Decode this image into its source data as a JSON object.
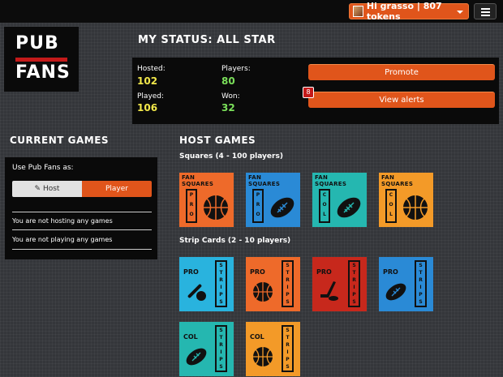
{
  "topbar": {
    "user_label": "Hi grasso | 807 tokens"
  },
  "logo": {
    "line1": "PUB",
    "line2": "FANS"
  },
  "status": {
    "title": "MY STATUS: ALL STAR",
    "hosted_label": "Hosted:",
    "hosted": "102",
    "players_label": "Players:",
    "players": "80",
    "played_label": "Played:",
    "played": "106",
    "won_label": "Won:",
    "won": "32",
    "promote_label": "Promote",
    "alerts_label": "View alerts",
    "alert_count": "8"
  },
  "current_games": {
    "title": "CURRENT GAMES",
    "use_label": "Use Pub Fans as:",
    "host_option": "Host",
    "player_option": "Player",
    "hosting_msg": "You are not hosting any games",
    "playing_msg": "You are not playing any games"
  },
  "host_games": {
    "title": "HOST GAMES",
    "squares_label": "Squares (4 - 100 players)",
    "strips_label": "Strip Cards (2 - 10 players)",
    "squares": [
      {
        "line1": "FAN",
        "line2": "SQUARES",
        "level": "PRO",
        "sport": "basketball-icon",
        "color": "#ee6a2a"
      },
      {
        "line1": "FAN",
        "line2": "SQUARES",
        "level": "PRO",
        "sport": "football-icon",
        "color": "#2a8ad6"
      },
      {
        "line1": "FAN",
        "line2": "SQUARES",
        "level": "COL",
        "sport": "football-icon",
        "color": "#25b7b0"
      },
      {
        "line1": "FAN",
        "line2": "SQUARES",
        "level": "COL",
        "sport": "basketball-icon",
        "color": "#f39a28"
      }
    ],
    "strips": [
      {
        "level": "PRO",
        "word": "STRIPS",
        "sport": "baseball-icon",
        "color": "#29b3de"
      },
      {
        "level": "PRO",
        "word": "STRIPS",
        "sport": "basketball-icon",
        "color": "#ee6a2a"
      },
      {
        "level": "PRO",
        "word": "STRIPS",
        "sport": "hockey-icon",
        "color": "#c7281c"
      },
      {
        "level": "PRO",
        "word": "STRIPS",
        "sport": "football-icon",
        "color": "#2a8ad6"
      },
      {
        "level": "COL",
        "word": "STRIPS",
        "sport": "football-icon",
        "color": "#25b7b0"
      },
      {
        "level": "COL",
        "word": "STRIPS",
        "sport": "basketball-icon",
        "color": "#f39a28"
      }
    ]
  }
}
